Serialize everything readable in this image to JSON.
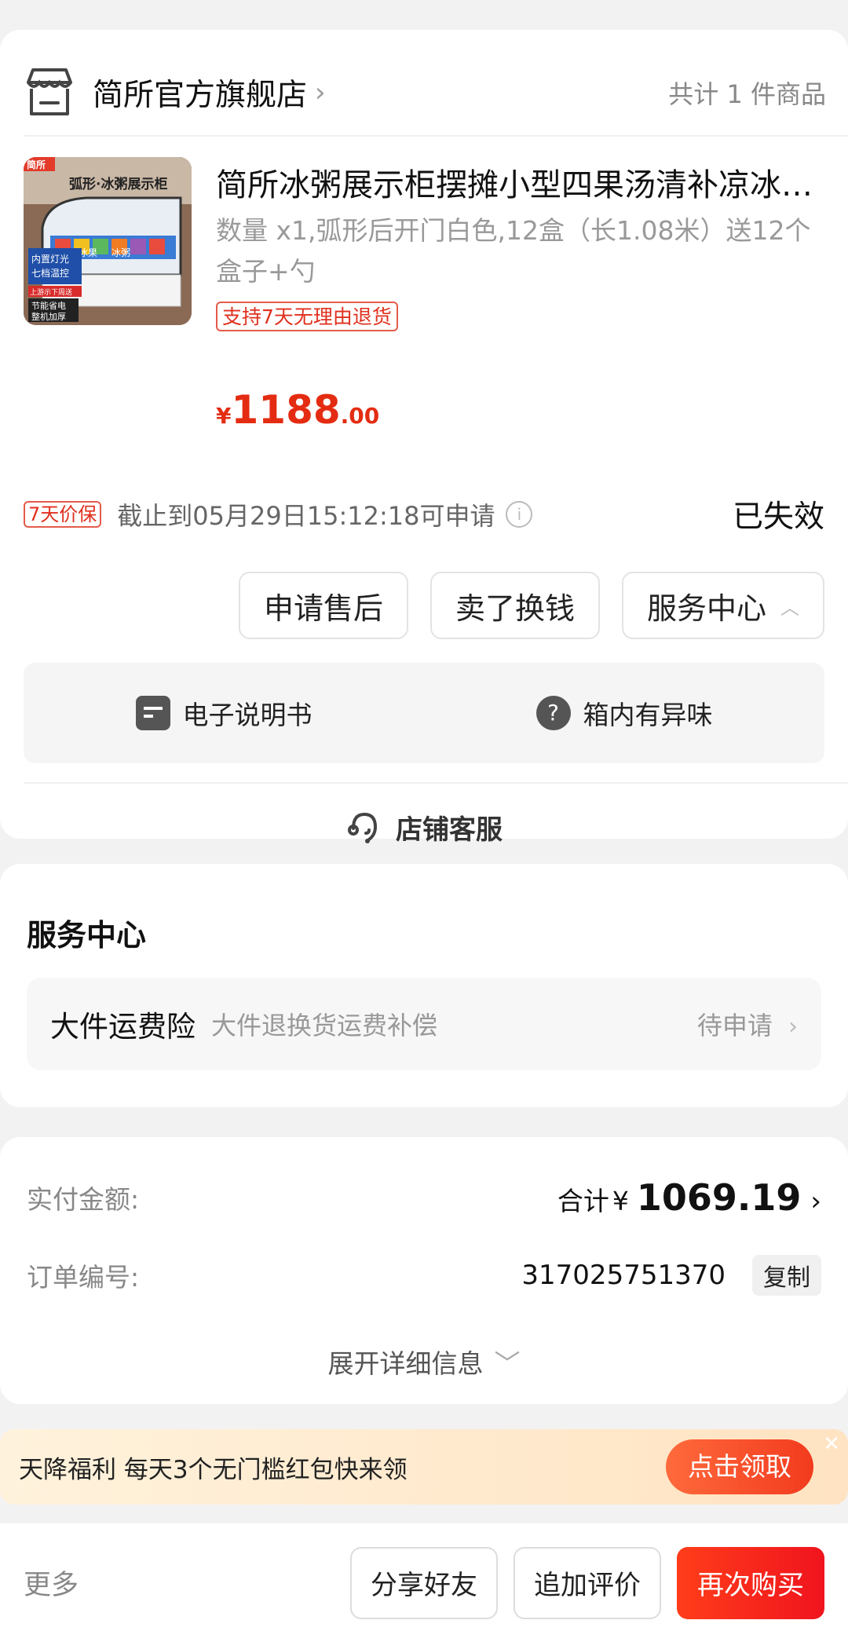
{
  "store": {
    "name": "简所官方旗舰店",
    "item_count": "共计 1 件商品"
  },
  "product": {
    "thumb_texts": [
      "简所",
      "弧形·冰粥展示柜",
      "冰果",
      "冰粥",
      "内置灯光",
      "七档温控",
      "上游示下周送",
      "节能省电",
      "整机加厚"
    ],
    "title": "简所冰粥展示柜摆摊小型四果汤清补凉冰…",
    "spec": "数量 x1,弧形后开门白色,12盒（长1.08米）送12个盒子+勺",
    "refund_tag": "支持7天无理由退货",
    "price_currency": "¥",
    "price_int": "1188",
    "price_dec": ".00"
  },
  "price_protect": {
    "tag": "7天价保",
    "text": "截止到05月29日15:12:18可申请",
    "status": "已失效"
  },
  "actions": {
    "after_sale": "申请售后",
    "sell": "卖了换钱",
    "service_center": "服务中心"
  },
  "service_popup": {
    "manual": "电子说明书",
    "odor": "箱内有异味"
  },
  "customer_service": "店铺客服",
  "service_center": {
    "title": "服务中心",
    "item_name": "大件运费险",
    "item_desc": "大件退换货运费补偿",
    "item_status": "待申请"
  },
  "payment": {
    "paid_label": "实付金额:",
    "total_prefix": "合计",
    "currency": "¥",
    "total": "1069.19",
    "order_label": "订单编号:",
    "order_no": "317025751370",
    "copy": "复制",
    "expand": "展开详细信息"
  },
  "promo": {
    "text": "天降福利 每天3个无门槛红包快来领",
    "button": "点击领取"
  },
  "bottom": {
    "more": "更多",
    "share": "分享好友",
    "review": "追加评价",
    "rebuy": "再次购买"
  },
  "colors": {
    "accent_red": "#e42c12",
    "background": "#f2f2f2"
  }
}
